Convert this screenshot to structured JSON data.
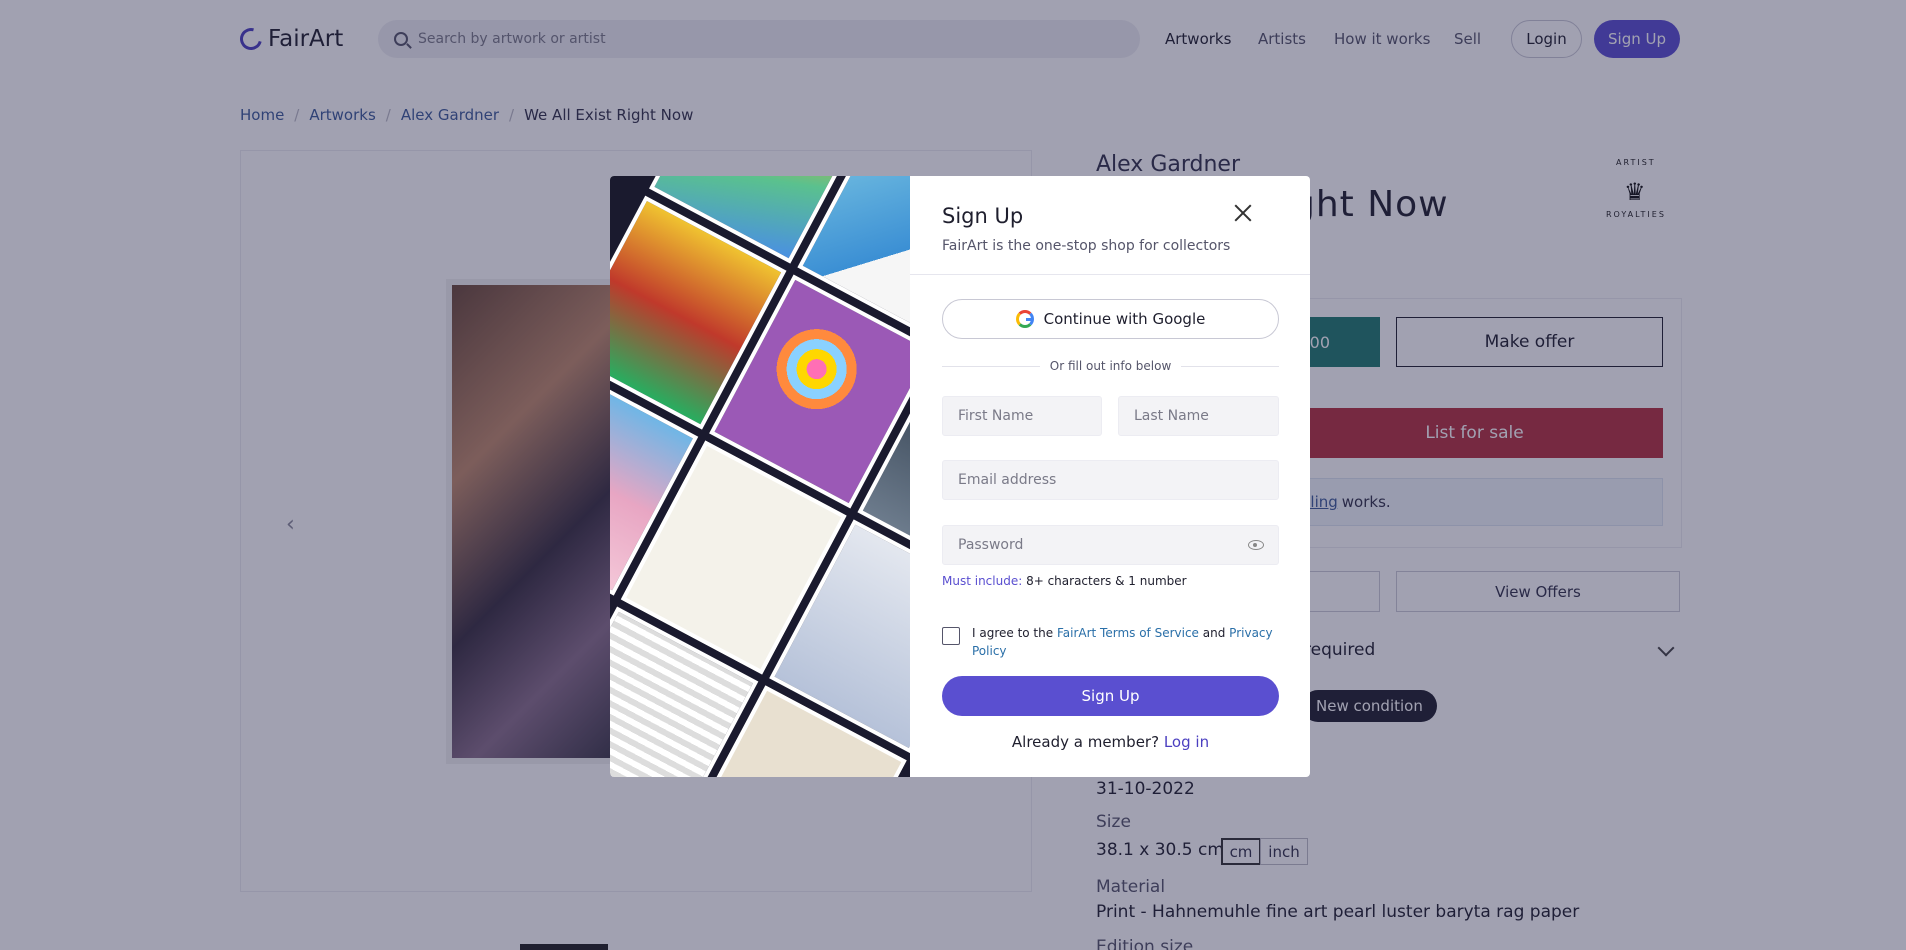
{
  "header": {
    "logo_text": "FairArt",
    "search_placeholder": "Search by artwork or artist",
    "nav": [
      "Artworks",
      "Artists",
      "How it works",
      "Sell"
    ],
    "login_label": "Login",
    "signup_label": "Sign Up"
  },
  "breadcrumb": [
    "Home",
    "Artworks",
    "Alex Gardner",
    "We All Exist Right Now"
  ],
  "product": {
    "artist": "Alex Gardner",
    "title_visible": "ight Now",
    "royalty_top": "ARTIST",
    "royalty_bottom": "ROYALTIES",
    "buy_price_partial": "00",
    "make_offer_label": "Make offer",
    "list_for_sale_label": "List for sale",
    "sell_link_partial": "elling",
    "sell_note_suffix": "works.",
    "view_offers_label": "View Offers",
    "auth_partial": "required",
    "condition_badge": "New condition",
    "date": "31-10-2022",
    "size_label": "Size",
    "size_value": "38.1 x 30.5 cm",
    "unit_cm": "cm",
    "unit_inch": "inch",
    "material_label": "Material",
    "material_value": "Print - Hahnemuhle fine art pearl luster baryta rag paper",
    "edition_label_partial": "Edition size"
  },
  "modal": {
    "title": "Sign Up",
    "subtitle": "FairArt is the one-stop shop for collectors",
    "google_label": "Continue with Google",
    "or_text": "Or fill out info below",
    "first_name_placeholder": "First Name",
    "last_name_placeholder": "Last Name",
    "email_placeholder": "Email address",
    "password_placeholder": "Password",
    "pw_hint_key": "Must include:",
    "pw_hint_value": "8+ characters & 1 number",
    "agree_prefix": "I agree to the",
    "terms_link": "FairArt Terms of Service",
    "agree_and": "and",
    "privacy_link": "Privacy Policy",
    "submit_label": "Sign Up",
    "member_prefix": "Already a member?",
    "login_link": "Log in"
  },
  "colors": {
    "brand": "#5a4fd0",
    "buy": "#1f7a6e",
    "list": "#b5313f",
    "overlay": "rgba(30,30,70,0.42)"
  }
}
